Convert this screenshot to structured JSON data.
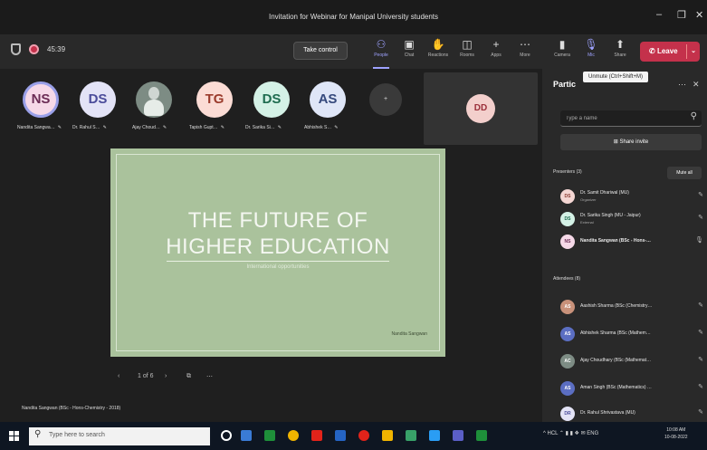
{
  "window": {
    "title": "Invitation for Webinar for Manipal University students",
    "minimize_glyph": "–",
    "restore_glyph": "❐",
    "close_glyph": "✕"
  },
  "toolbar": {
    "timer": "45:39",
    "take_control_label": "Take control",
    "buttons": [
      {
        "label": "People",
        "icon": "people-icon",
        "glyph": "⚇"
      },
      {
        "label": "Chat",
        "icon": "chat-icon",
        "glyph": "▣"
      },
      {
        "label": "Reactions",
        "icon": "reactions-icon",
        "glyph": "✋"
      },
      {
        "label": "Rooms",
        "icon": "rooms-icon",
        "glyph": "◫"
      },
      {
        "label": "Apps",
        "icon": "apps-icon",
        "glyph": "+"
      },
      {
        "label": "More",
        "icon": "more-icon",
        "glyph": "⋯"
      },
      {
        "label": "Camera",
        "icon": "camera-icon",
        "glyph": "▮"
      },
      {
        "label": "Mic",
        "icon": "mic-icon",
        "glyph": "🎙"
      },
      {
        "label": "Share",
        "icon": "share-icon",
        "glyph": "⬆"
      }
    ],
    "leave_label": "Leave",
    "leave_glyph": "✆",
    "leave_chevron": "⌄"
  },
  "stage": {
    "participants": [
      {
        "initials": "NS",
        "name": "Nandita Sangwa…",
        "bg": "#f6d9e8",
        "fg": "#6b2c55",
        "speaking": true
      },
      {
        "initials": "DS",
        "name": "Dr. Rahul S…",
        "bg": "#e3e3f6",
        "fg": "#4b4c9a"
      },
      {
        "initials": "",
        "name": "Ajay Choud…",
        "photo": true
      },
      {
        "initials": "TG",
        "name": "Tapish Gupt…",
        "bg": "#fbdcd5",
        "fg": "#9b3b2c"
      },
      {
        "initials": "DS",
        "name": "Dr. Sarika Si…",
        "bg": "#d4f1e6",
        "fg": "#1e6b4f"
      },
      {
        "initials": "AS",
        "name": "Abhishek S…",
        "bg": "#dfe6f7",
        "fg": "#35497c"
      }
    ],
    "mic_glyph": "✎",
    "more_count": "+",
    "dd_initials": "DD",
    "slide": {
      "title_line1": "THE FUTURE OF",
      "title_line2": "HIGHER EDUCATION",
      "subtitle": "International opportunities",
      "author": "Nandita Sangwan"
    },
    "slide_nav": {
      "prev": "‹",
      "page": "1 of 6",
      "next": "›",
      "copy_glyph": "⧉",
      "more": "⋯"
    },
    "presenter_label": "Nandita Sangwan (BSc - Hons-Chemistry - 2018)"
  },
  "panel": {
    "title": "Partic",
    "tooltip": "Unmute (Ctrl+Shift+M)",
    "more_glyph": "⋯",
    "close_glyph": "✕",
    "search_placeholder": "Type a name",
    "search_glyph": "⚲",
    "share_invite_label": "Share invite",
    "share_invite_glyph": "⊞",
    "presenters_header": "Presenters (3)",
    "mute_all_label": "Mute all",
    "presenters": [
      {
        "initials": "DS",
        "name": "Dr. Samit Dhariwal (MU)",
        "role": "Organizer",
        "bg": "#f4d6d3",
        "fg": "#8a3c33",
        "mic": "✎"
      },
      {
        "initials": "DS",
        "name": "Dr. Sarika Singh (MU - Jaipur)",
        "role": "External",
        "bg": "#d4f1e6",
        "fg": "#1e6b4f",
        "mic": "✎"
      },
      {
        "initials": "NS",
        "name": "Nandita Sangwan (BSc - Hons-…",
        "role": "",
        "bg": "#f6d9e8",
        "fg": "#6b2c55",
        "mic": "🎙",
        "bold": true
      }
    ],
    "attendees_header": "Attendees (8)",
    "attendees": [
      {
        "initials": "AS",
        "name": "Aashish Sharma (BSc (Chemistry…",
        "bg": "#c8917a",
        "fg": "#fff",
        "mic": "✎"
      },
      {
        "initials": "AS",
        "name": "Abhishek Sharma (BSc (Mathem…",
        "bg": "#5b6ec2",
        "fg": "#fff",
        "mic": "✎"
      },
      {
        "initials": "AC",
        "name": "Ajay Choudhary (BSc (Mathemat…",
        "bg": "#7d8c84",
        "fg": "#fff",
        "mic": "✎"
      },
      {
        "initials": "AS",
        "name": "Aman Singh (BSc (Mathematics) …",
        "bg": "#5b6ec2",
        "fg": "#fff",
        "mic": "✎"
      },
      {
        "initials": "DR",
        "name": "Dr. Rahul Shrivastava (MU)",
        "bg": "#e3e3f6",
        "fg": "#4b4c9a",
        "mic": "✎"
      }
    ]
  },
  "taskbar": {
    "search_placeholder": "Type here to search",
    "search_glyph": "⚲",
    "tray_text": "^ HCL ⌃ ▮ ▮ ❖ ✉ ENG",
    "time": "10:08 AM",
    "date": "10-08-2022",
    "app_colors": [
      "#ffffff",
      "#3a7bd5",
      "#1e8f3a",
      "#f0b400",
      "#e2231a",
      "#2564c4",
      "#7a5cd1",
      "#1e8f3a",
      "#f0b400",
      "#5b5fc7",
      "#2a9df4",
      "#38a169"
    ]
  }
}
